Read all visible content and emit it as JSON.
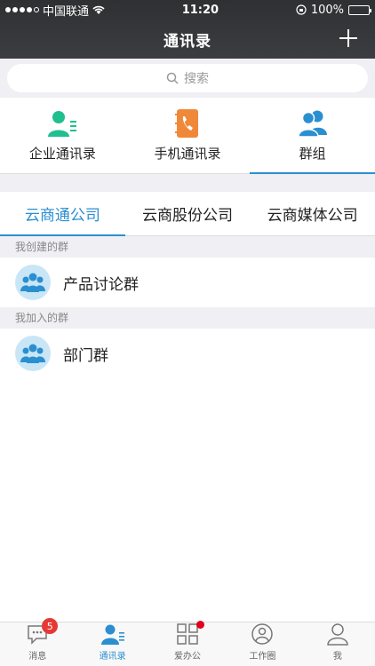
{
  "status": {
    "carrier": "中国联通",
    "time": "11:20",
    "battery": "100%"
  },
  "header": {
    "title": "通讯录"
  },
  "search": {
    "placeholder": "搜索"
  },
  "categories": [
    {
      "label": "企业通讯录",
      "icon": "enterprise-contacts-icon",
      "color": "#1fbf8f"
    },
    {
      "label": "手机通讯录",
      "icon": "phone-book-icon",
      "color": "#f0883a"
    },
    {
      "label": "群组",
      "icon": "group-icon",
      "color": "#2a8fd0",
      "active": true
    }
  ],
  "companies": [
    {
      "label": "云商通公司",
      "active": true
    },
    {
      "label": "云商股份公司"
    },
    {
      "label": "云商媒体公司"
    }
  ],
  "sections": {
    "created": {
      "title": "我创建的群",
      "groups": [
        "产品讨论群"
      ]
    },
    "joined": {
      "title": "我加入的群",
      "groups": [
        "部门群"
      ]
    }
  },
  "tabbar": [
    {
      "label": "消息",
      "icon": "message-icon",
      "badge": "5"
    },
    {
      "label": "通讯录",
      "icon": "contacts-icon",
      "active": true
    },
    {
      "label": "爱办公",
      "icon": "apps-grid-icon",
      "dot": true
    },
    {
      "label": "工作圈",
      "icon": "work-circle-icon"
    },
    {
      "label": "我",
      "icon": "profile-icon"
    }
  ],
  "colors": {
    "accent": "#2a8fd0",
    "header_bg": "#3a3b3e",
    "badge": "#e53935"
  }
}
